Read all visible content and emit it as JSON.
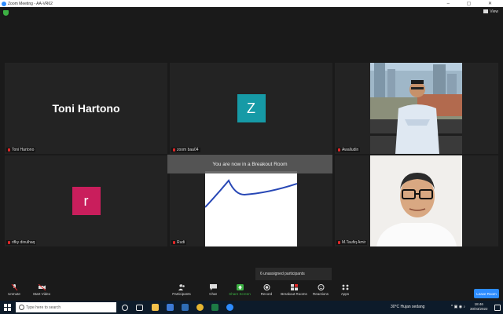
{
  "window": {
    "title": "Zoom Meeting - AA-VR62",
    "controls": "–  ▢  ✕"
  },
  "view_label": "View",
  "participants": [
    {
      "name": "Toni Hartono",
      "big_name": "Toni Hartono"
    },
    {
      "name": "zoom baa04",
      "avatar_letter": "Z",
      "avatar_color": "#169aa6"
    },
    {
      "name": "Awalludin"
    },
    {
      "name": "rifky dinulhaq",
      "avatar_letter": "r",
      "avatar_color": "#c91e5c"
    },
    {
      "name": "Rudi"
    },
    {
      "name": "M.Taufiq Amir"
    }
  ],
  "breakout_banner": "You are now in a Breakout Room",
  "unassigned_popup": "6 unassigned participants",
  "toolbar": {
    "unmute": "Unmute",
    "start_video": "Start Video",
    "participants": "Participants",
    "participants_count": "6",
    "chat": "Chat",
    "share_screen": "Share Screen",
    "record": "Record",
    "breakout_rooms": "Breakout Rooms",
    "reactions": "Reactions",
    "apps": "Apps",
    "leave": "Leave Room"
  },
  "colors": {
    "share_green": "#3cb043",
    "leave_blue": "#2d8cff",
    "mute_red": "#e02828"
  },
  "taskbar": {
    "search_placeholder": "Type here to search",
    "weather": "30°C  Hujan sedang",
    "time": "18:46",
    "date": "30/03/2022"
  }
}
